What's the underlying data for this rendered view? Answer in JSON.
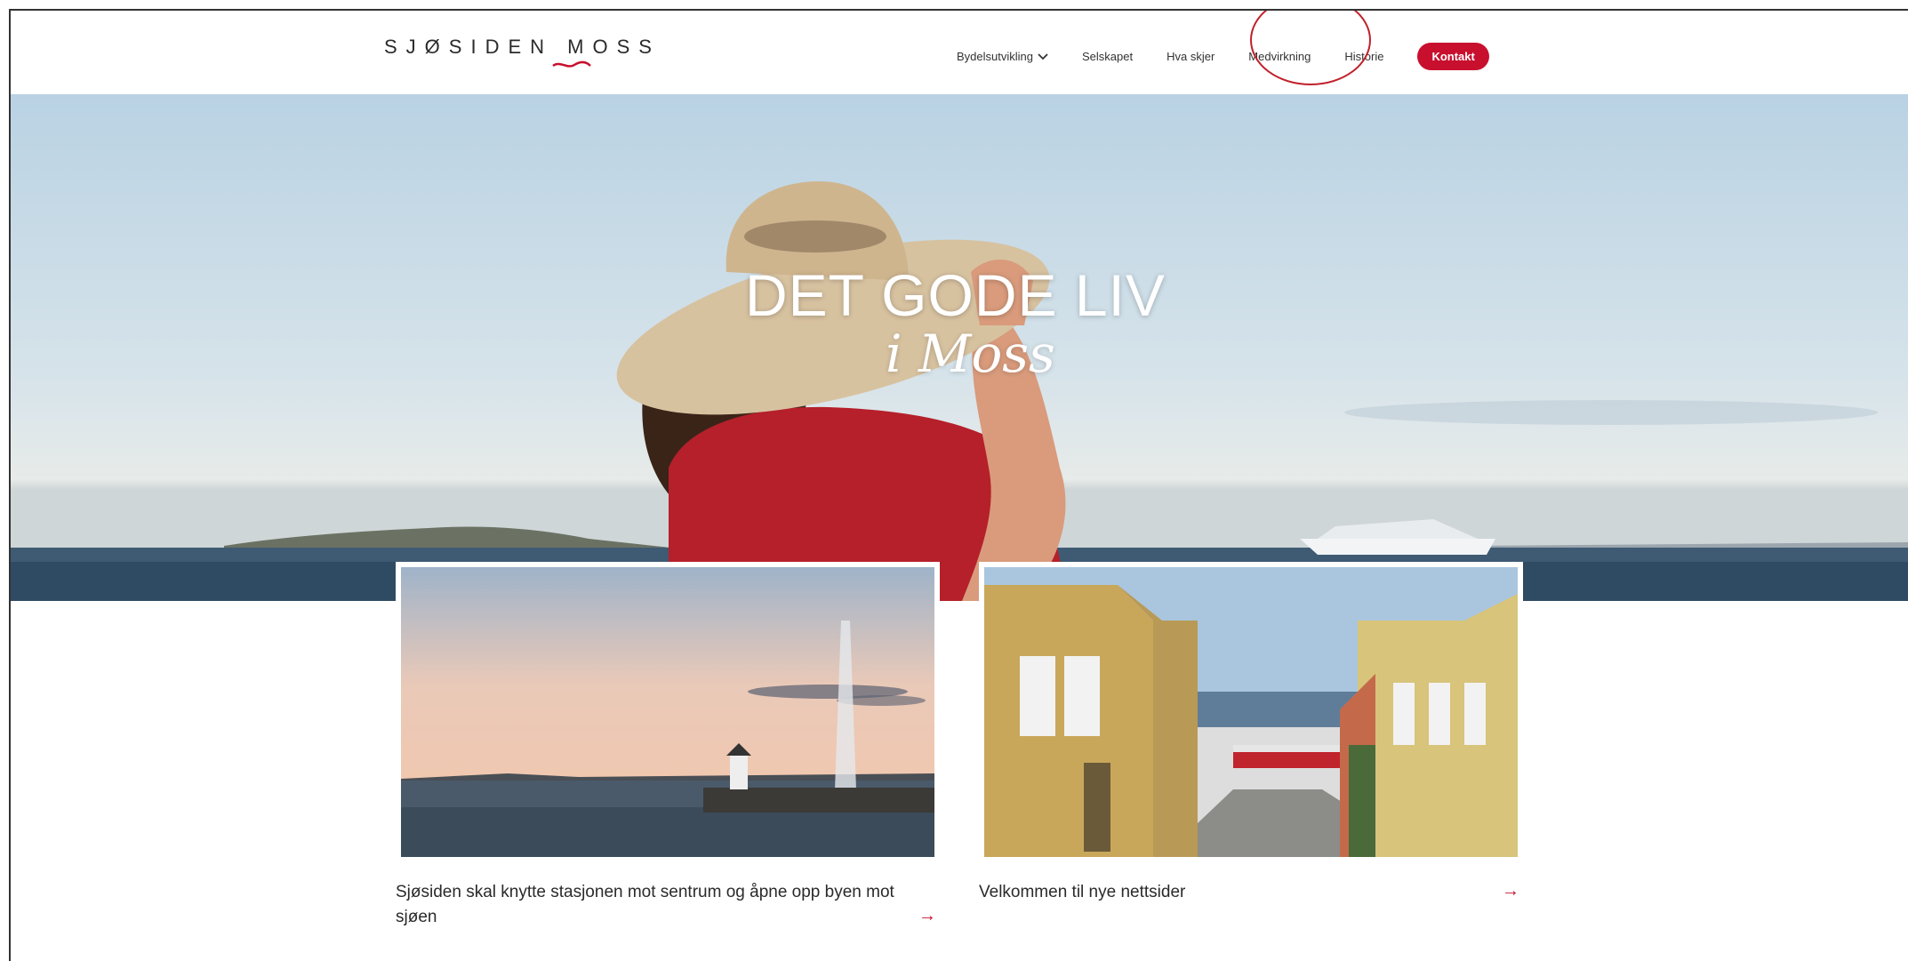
{
  "header": {
    "logo_text": "SJØSIDEN MOSS",
    "nav": [
      {
        "label": "Bydelsutvikling",
        "has_dropdown": true
      },
      {
        "label": "Selskapet"
      },
      {
        "label": "Hva skjer"
      },
      {
        "label": "Medvirkning"
      },
      {
        "label": "Historie"
      }
    ],
    "contact_button": "Kontakt"
  },
  "hero": {
    "title": "DET GODE LIV",
    "script": "i Moss"
  },
  "cards": [
    {
      "caption": "Sjøsiden skal knytte stasjonen mot sentrum og åpne opp byen mot sjøen",
      "arrow": "→"
    },
    {
      "caption": "Velkommen til nye nettsider",
      "arrow": "→"
    }
  ],
  "colors": {
    "accent": "#c8102e",
    "annotation_circle": "#c0202a"
  }
}
